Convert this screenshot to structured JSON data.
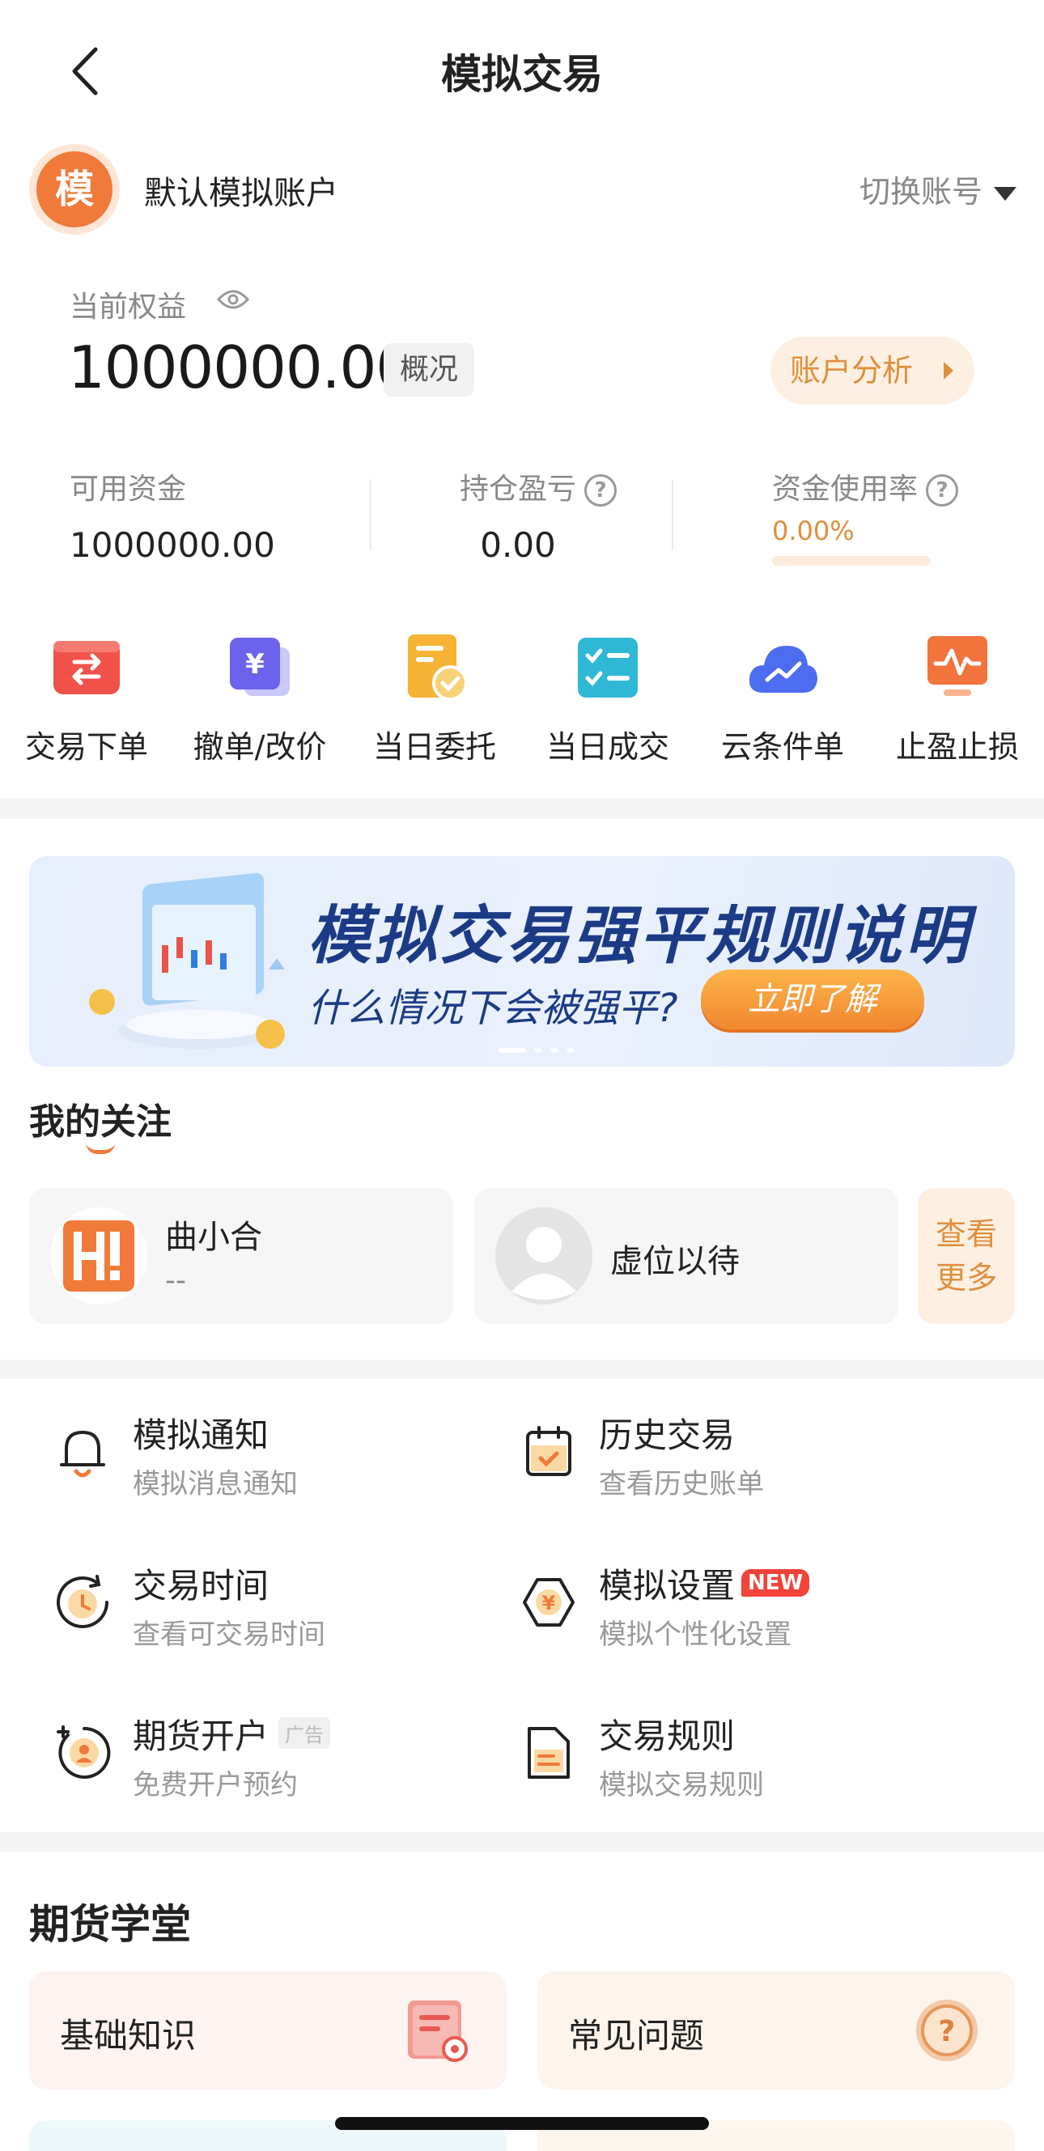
{
  "header": {
    "title": "模拟交易"
  },
  "account": {
    "avatar_char": "模",
    "name": "默认模拟账户",
    "switch_label": "切换账号"
  },
  "equity": {
    "label": "当前权益",
    "value": "1000000.00",
    "overview_label": "概况",
    "analysis_label": "账户分析"
  },
  "stats": {
    "available": {
      "label": "可用资金",
      "value": "1000000.00"
    },
    "pnl": {
      "label": "持仓盈亏",
      "value": "0.00"
    },
    "usage": {
      "label": "资金使用率",
      "value": "0.00%",
      "fraction": 0.0
    }
  },
  "actions": [
    {
      "label": "交易下单",
      "icon": "swap-icon"
    },
    {
      "label": "撤单/改价",
      "icon": "yen-card-icon"
    },
    {
      "label": "当日委托",
      "icon": "doc-check-icon"
    },
    {
      "label": "当日成交",
      "icon": "checklist-icon"
    },
    {
      "label": "云条件单",
      "icon": "cloud-chart-icon"
    },
    {
      "label": "止盈止损",
      "icon": "pulse-chart-icon"
    }
  ],
  "banner": {
    "title": "模拟交易强平规则说明",
    "subtitle": "什么情况下会被强平?",
    "button": "立即了解"
  },
  "follows": {
    "title": "我的关注",
    "items": [
      {
        "name": "曲小合",
        "sub": "--"
      },
      {
        "name": "虚位以待",
        "sub": ""
      }
    ],
    "see_more": "查看更多"
  },
  "menu": [
    {
      "title": "模拟通知",
      "sub": "模拟消息通知",
      "icon": "bell-icon"
    },
    {
      "title": "历史交易",
      "sub": "查看历史账单",
      "icon": "calendar-check-icon"
    },
    {
      "title": "交易时间",
      "sub": "查看可交易时间",
      "icon": "clock-icon"
    },
    {
      "title": "模拟设置",
      "sub": "模拟个性化设置",
      "icon": "yen-hexagon-icon",
      "badge": "NEW"
    },
    {
      "title": "期货开户",
      "sub": "免费开户预约",
      "icon": "user-plus-icon",
      "badge": "广告"
    },
    {
      "title": "交易规则",
      "sub": "模拟交易规则",
      "icon": "document-icon"
    }
  ],
  "school": {
    "title": "期货学堂",
    "cards": [
      {
        "label": "基础知识",
        "icon": "knowledge-icon"
      },
      {
        "label": "常见问题",
        "icon": "question-icon"
      }
    ]
  },
  "colors": {
    "accent": "#e08f3c",
    "brand_orange": "#f07a3a",
    "navy": "#1c3b86",
    "red_badge": "#f0433a"
  }
}
